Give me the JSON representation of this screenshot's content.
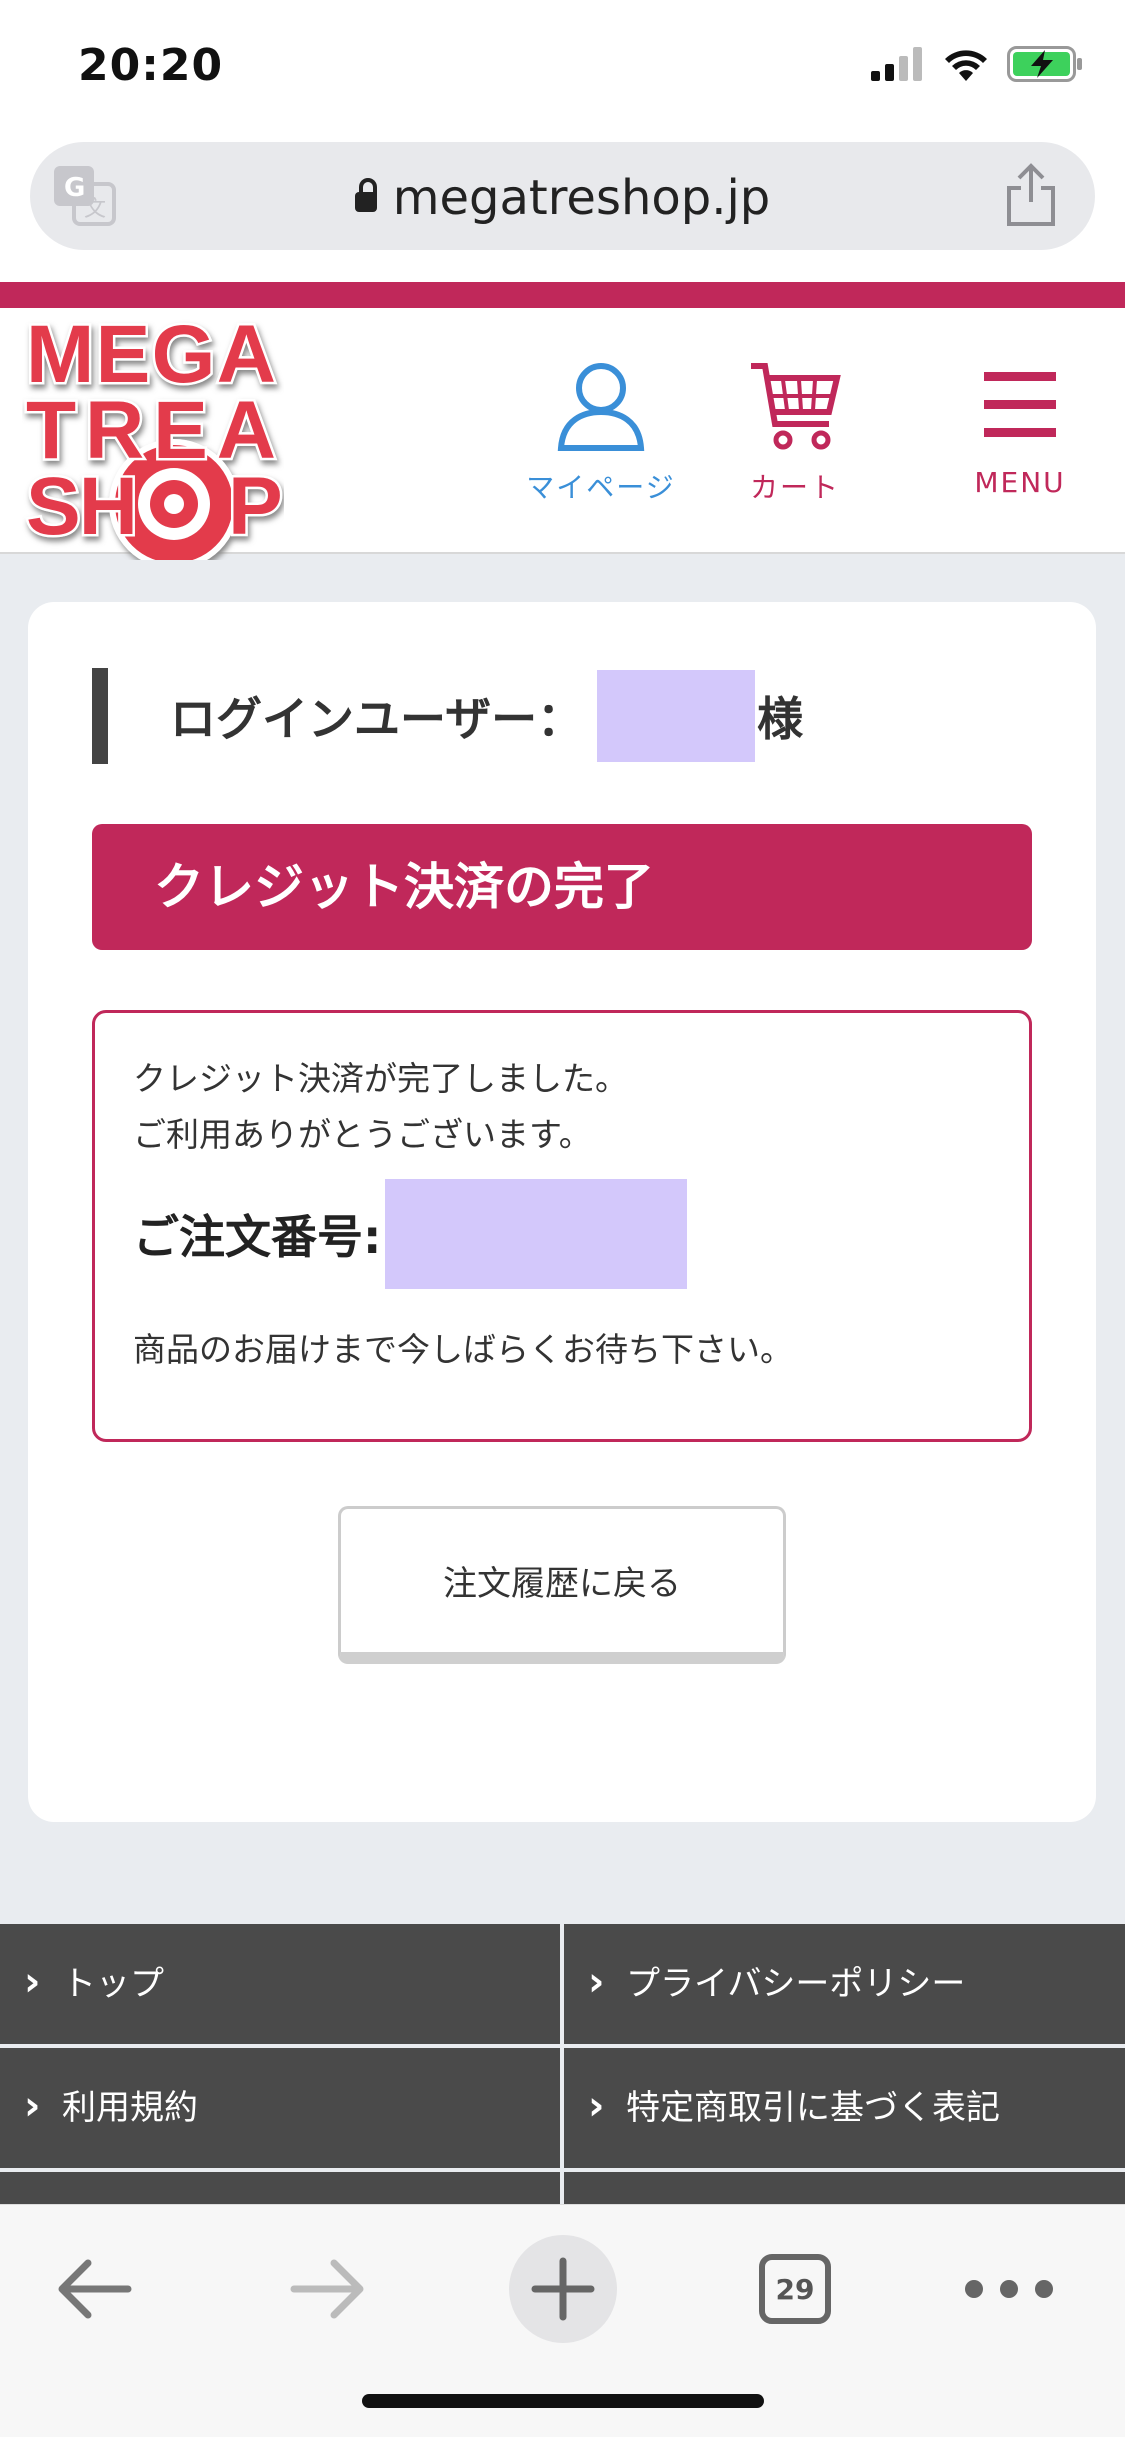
{
  "status_bar": {
    "time": "20:20"
  },
  "browser": {
    "url": "megatreshop.jp",
    "tab_count": "29"
  },
  "header": {
    "logo_text": "MEGA TREA SHOP",
    "nav": {
      "mypage": "マイページ",
      "cart": "カート",
      "menu": "MENU"
    },
    "accent_color": "#c0285a"
  },
  "main": {
    "login_label": "ログインユーザー：",
    "login_suffix": "様",
    "section_title": "クレジット決済の完了",
    "message_line1": "クレジット決済が完了しました。",
    "message_line2": "ご利用ありがとうございます。",
    "order_label": "ご注文番号:",
    "notice": "商品のお届けまで今しばらくお待ち下さい。",
    "back_button": "注文履歴に戻る"
  },
  "footer": {
    "links": [
      "トップ",
      "プライバシーポリシー",
      "利用規約",
      "特定商取引に基づく表記"
    ]
  }
}
